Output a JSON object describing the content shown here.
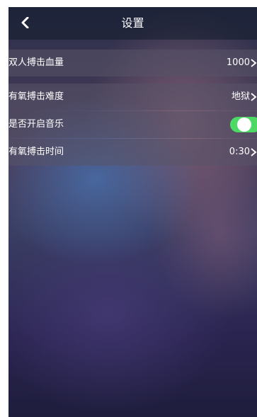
{
  "header": {
    "title": "设置",
    "back_icon": "chevron-left-icon"
  },
  "settings": [
    {
      "label": "双人搏击血量",
      "value": "1000"
    },
    {
      "label": "有氧搏击难度",
      "value": "地狱"
    },
    {
      "label": "是否开启音乐",
      "toggle_on": true
    },
    {
      "label": "有氧搏击时间",
      "value": "0:30"
    }
  ],
  "colors": {
    "toggle_on": "#4cd964",
    "text": "#ffffff",
    "header_bg": "rgba(18,28,44,0.55)"
  }
}
